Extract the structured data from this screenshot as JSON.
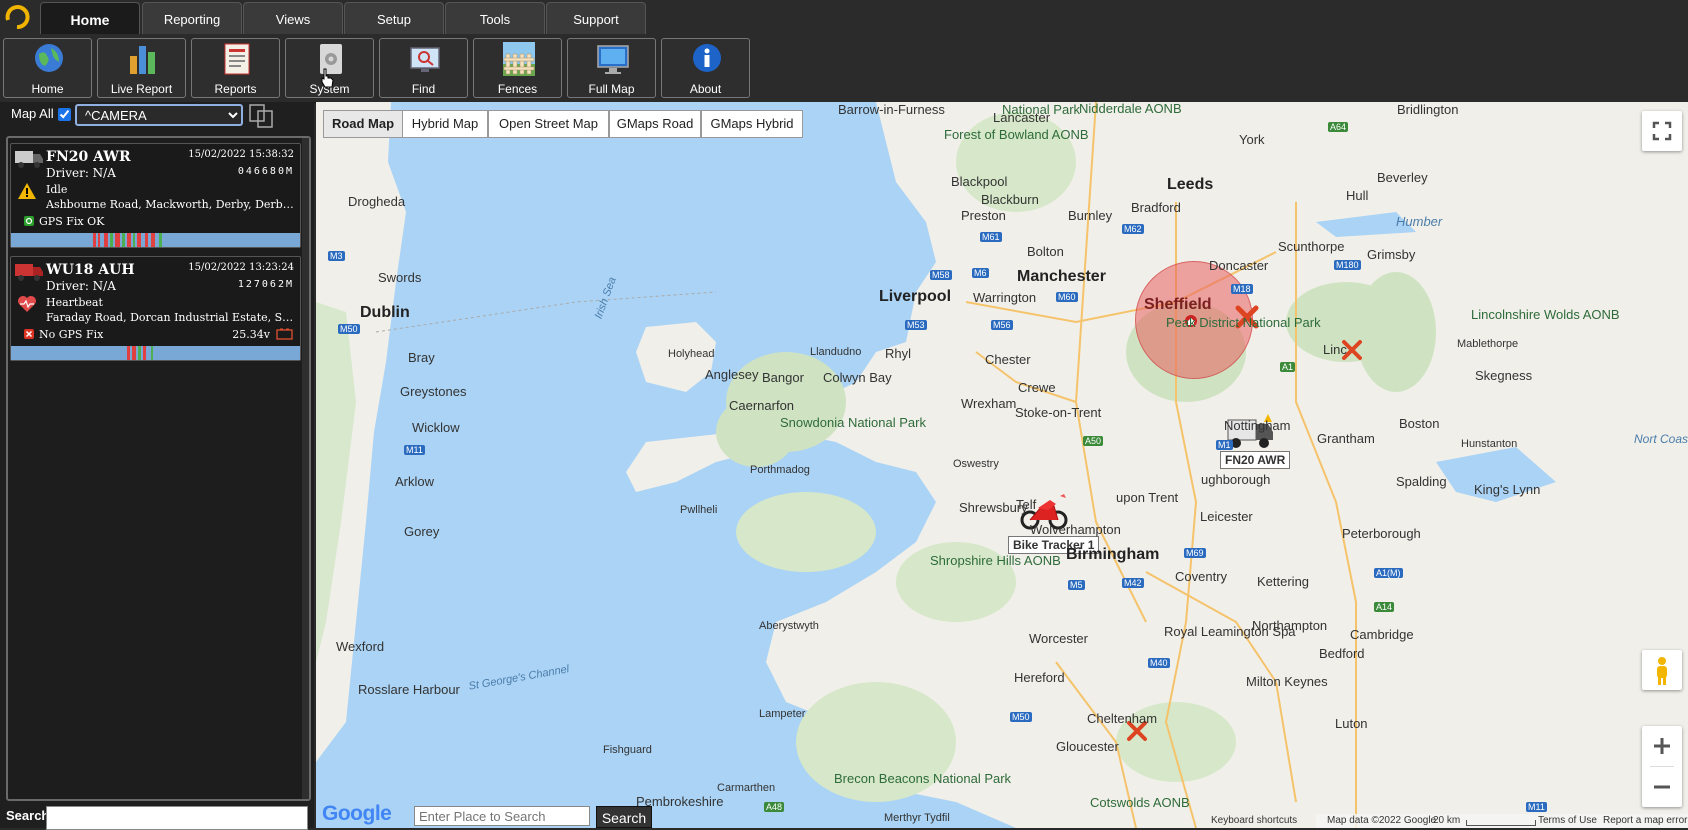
{
  "nav": {
    "tabs": [
      "Home",
      "Reporting",
      "Views",
      "Setup",
      "Tools",
      "Support"
    ],
    "active_tab": "Home"
  },
  "toolbar": {
    "home": "Home",
    "live_report": "Live Report",
    "reports": "Reports",
    "system": "System",
    "find": "Find",
    "fences": "Fences",
    "full_map": "Full Map",
    "about": "About"
  },
  "sidebar": {
    "map_all_label": "Map All",
    "map_all_checked": true,
    "group_select": "^CAMERA",
    "search_label": "Search",
    "vehicles": [
      {
        "reg": "FN20 AWR",
        "date": "15/02/2022 15:38:32",
        "driver": "Driver: N/A",
        "odometer": "046680M",
        "status": "Idle",
        "address": "Ashbourne Road, Mackworth, Derby, Derbyshire, ...",
        "gps": "GPS Fix OK",
        "voltage": ""
      },
      {
        "reg": "WU18 AUH",
        "date": "15/02/2022 13:23:24",
        "driver": "Driver: N/A",
        "odometer": "127062M",
        "status": "Heartbeat",
        "address": "Faraday Road, Dorcan Industrial Estate, Swindon,...",
        "gps": "No GPS Fix",
        "voltage": "25.34v"
      }
    ]
  },
  "map": {
    "types": [
      "Road Map",
      "Hybrid Map",
      "Open Street Map",
      "GMaps Road",
      "GMaps Hybrid"
    ],
    "active_type": "Road Map",
    "place_search_placeholder": "Enter Place to Search",
    "search_button": "Search",
    "markers": {
      "truck_label": "FN20 AWR",
      "bike_label": "Bike Tracker 1",
      "geofence_label": "Sheffield"
    },
    "attribution": {
      "google": "Google",
      "shortcuts": "Keyboard shortcuts",
      "data": "Map data ©2022 Google",
      "scale": "20 km",
      "terms": "Terms of Use",
      "report": "Report a map error"
    },
    "places": {
      "leeds": "Leeds",
      "bradford": "Bradford",
      "manchester": "Manchester",
      "liverpool": "Liverpool",
      "sheffield_district": "Peak District National Park",
      "nottingham": "Nottingham",
      "birmingham": "Birmingham",
      "wolverhampton": "Wolverhampton",
      "dublin": "Dublin",
      "stoke": "Stoke-on-Trent",
      "leicester": "Leicester",
      "coventry": "Coventry",
      "blackpool": "Blackpool",
      "preston": "Preston",
      "doncaster": "Doncaster",
      "hull": "Hull",
      "york": "York",
      "lincoln": "Linc",
      "grantham": "Grantham",
      "derby_upon": "upon Trent",
      "loughborough": "ughborough",
      "chester": "Chester",
      "crewe": "Crewe",
      "wrexham": "Wrexham",
      "shrewsbury": "Shrewsbury",
      "telford": "Telf",
      "worcester": "Worcester",
      "hereford": "Hereford",
      "cheltenham": "Cheltenham",
      "gloucester": "Gloucester",
      "northampton": "Northampton",
      "cambridge": "Cambridge",
      "peterborough": "Peterborough",
      "bedford": "Bedford",
      "milton_keynes": "Milton Keynes",
      "luton": "Luton",
      "kettering": "Kettering",
      "royal_leamington": "Royal Leamington Spa",
      "boston": "Boston",
      "spalding": "Spalding",
      "kings_lynn": "King's Lynn",
      "skegness": "Skegness",
      "scunthorpe": "Scunthorpe",
      "grimsby": "Grimsby",
      "bridlington": "Bridlington",
      "beverley": "Beverley",
      "humber": "Humber",
      "lancaster": "Lancaster",
      "barrow": "Barrow-in-Furness",
      "blackburn": "Blackburn",
      "burnley": "Burnley",
      "bolton": "Bolton",
      "warrington": "Warrington",
      "swords": "Swords",
      "drogheda": "Drogheda",
      "bray": "Bray",
      "greystones": "Greystones",
      "wicklow": "Wicklow",
      "arklow": "Arklow",
      "gorey": "Gorey",
      "wexford": "Wexford",
      "rosslare": "Rosslare Harbour",
      "holyhead": "Holyhead",
      "anglesey": "Anglesey",
      "bangor": "Bangor",
      "llandudno": "Llandudno",
      "rhyl": "Rhyl",
      "colwyn_bay": "Colwyn Bay",
      "caernarfon": "Caernarfon",
      "porthmadog": "Porthmadog",
      "pwllheli": "Pwllheli",
      "snowdonia": "Snowdonia National Park",
      "oswestry": "Oswestry",
      "aberystwyth": "Aberystwyth",
      "shropshire_hills": "Shropshire Hills AONB",
      "lampeter": "Lampeter",
      "carmarthen": "Carmarthen",
      "fishguard": "Fishguard",
      "pembrokeshire": "Pembrokeshire",
      "brecon": "Brecon Beacons National Park",
      "merthyr": "Merthyr Tydfil",
      "cotswolds": "Cotswolds AONB",
      "forest_bowland": "Forest of Bowland AONB",
      "nidderdale": "Nidderdale AONB",
      "national_park": "National Park",
      "lincs_wolds": "Lincolnshire Wolds AONB",
      "mablethorpe": "Mablethorpe",
      "hunstanton": "Hunstanton",
      "irish_sea": "Irish Sea",
      "st_georges": "St George's Channel",
      "north_coast": "Nort Coast"
    },
    "roads": [
      "M3",
      "M50",
      "M11",
      "M6",
      "M61",
      "M62",
      "M58",
      "M60",
      "M53",
      "M56",
      "A50",
      "M1",
      "A1",
      "M18",
      "M180",
      "A64",
      "M69",
      "M5",
      "M42",
      "M40",
      "A14",
      "A1(M)",
      "M50",
      "A48",
      "M11"
    ]
  }
}
